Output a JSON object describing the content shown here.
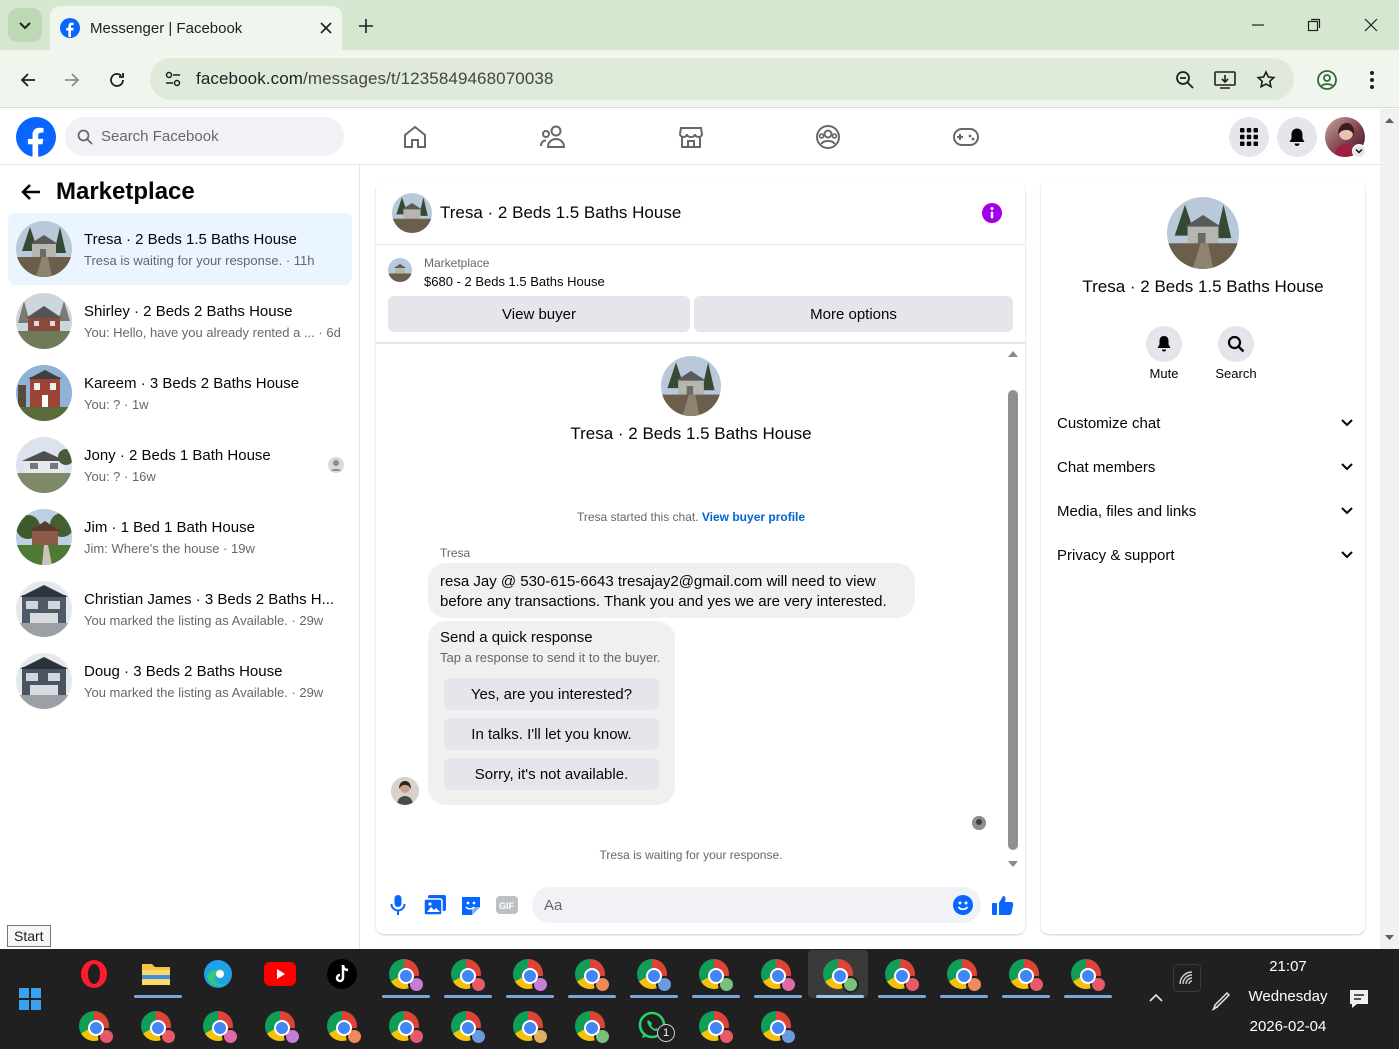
{
  "browser": {
    "tab_title": "Messenger | Facebook",
    "url_host": "facebook.com",
    "url_path": "/messages/t/1235849468070038"
  },
  "facebook": {
    "search_placeholder": "Search Facebook"
  },
  "left_panel": {
    "title": "Marketplace",
    "conversations": [
      {
        "name": "Tresa · 2 Beds 1.5 Baths House",
        "preview": "Tresa is waiting for your response. · 11h",
        "active": true
      },
      {
        "name": "Shirley · 2 Beds 2 Baths House",
        "preview": "You: Hello, have you already rented a ...  · 6d"
      },
      {
        "name": "Kareem · 3 Beds 2 Baths House",
        "preview": "You: ? · 1w"
      },
      {
        "name": "Jony · 2 Beds 1 Bath House",
        "preview": "You: ? · 16w"
      },
      {
        "name": "Jim · 1 Bed 1 Bath House",
        "preview": "Jim: Where's the house · 19w"
      },
      {
        "name": "Christian James · 3 Beds 2 Baths H...",
        "preview": "You marked the listing as Available. · 29w"
      },
      {
        "name": "Doug · 3 Beds 2 Baths House",
        "preview": "You marked the listing as Available. · 29w"
      }
    ]
  },
  "chat": {
    "header_name": "Tresa · 2 Beds 1.5 Baths House",
    "marketplace_label": "Marketplace",
    "listing": "$680 - 2 Beds 1.5 Baths House",
    "view_buyer": "View buyer",
    "more_options": "More options",
    "profile_name": "Tresa · 2 Beds 1.5 Baths House",
    "started_text": "Tresa started this chat.",
    "view_buyer_profile": "View buyer profile",
    "sender": "Tresa",
    "message_line1": "resa Jay @ 530-615-6643 tresajay2@gmail.com will need to view",
    "message_line2": "before any transactions. Thank you and yes we are very interested.",
    "quick_title": "Send a quick response",
    "quick_sub": "Tap a response to send it to the buyer.",
    "quick_responses": [
      "Yes, are you interested?",
      "In talks. I'll let you know.",
      "Sorry, it's not available."
    ],
    "waiting": "Tresa is waiting for your response.",
    "composer_placeholder": "Aa",
    "accent": "#0866ff"
  },
  "info_panel": {
    "name": "Tresa · 2 Beds 1.5 Baths House",
    "mute": "Mute",
    "search": "Search",
    "sections": [
      "Customize chat",
      "Chat members",
      "Media, files and links",
      "Privacy & support"
    ]
  },
  "taskbar": {
    "start_tooltip": "Start",
    "time": "21:07",
    "day": "Wednesday",
    "date": "2026-02-04",
    "whatsapp_badge": "1"
  }
}
